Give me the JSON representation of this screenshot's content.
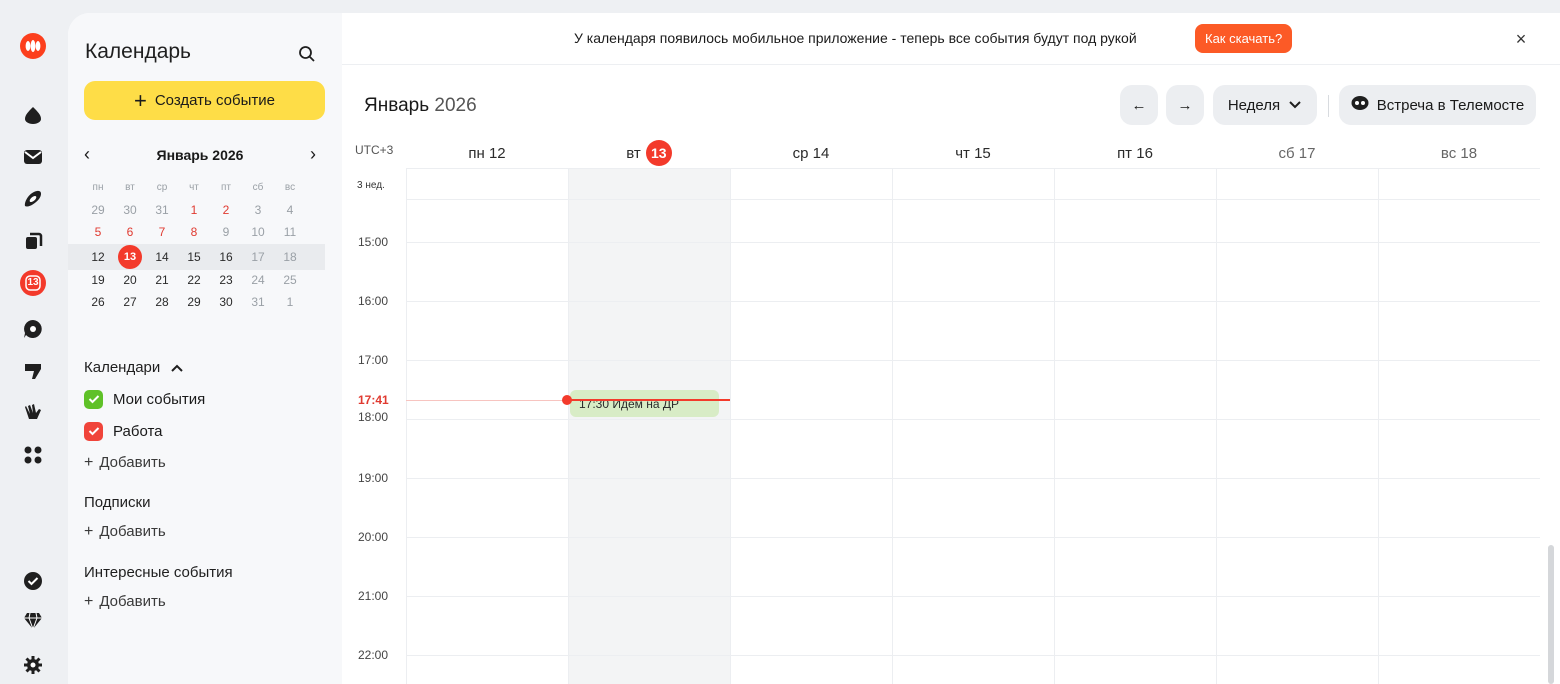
{
  "app": {
    "title": "Календарь"
  },
  "rail": {
    "icons": [
      "logo-icon",
      "drop-icon",
      "mail-icon",
      "disk-icon",
      "docs-icon",
      "calendar-icon",
      "chat-icon",
      "forms-icon",
      "hand-icon",
      "apps-icon",
      "done-icon",
      "gem-icon",
      "settings-icon"
    ],
    "calendar_badge": "13"
  },
  "sidebar": {
    "create_label": "Создать событие",
    "mini_cal": {
      "title": "Январь 2026",
      "dow": [
        "пн",
        "вт",
        "ср",
        "чт",
        "пт",
        "сб",
        "вс"
      ],
      "weeks": [
        [
          "29",
          "30",
          "31",
          "1",
          "2",
          "3",
          "4"
        ],
        [
          "5",
          "6",
          "7",
          "8",
          "9",
          "10",
          "11"
        ],
        [
          "12",
          "13",
          "14",
          "15",
          "16",
          "17",
          "18"
        ],
        [
          "19",
          "20",
          "21",
          "22",
          "23",
          "24",
          "25"
        ],
        [
          "26",
          "27",
          "28",
          "29",
          "30",
          "31",
          "1"
        ]
      ]
    },
    "calendars_title": "Календари",
    "calendars": [
      {
        "name": "Мои события",
        "color": "#5fc128"
      },
      {
        "name": "Работа",
        "color": "#f0443a"
      }
    ],
    "add_label": "Добавить",
    "subscriptions_title": "Подписки",
    "interesting_title": "Интересные события"
  },
  "banner": {
    "text": "У календаря появилось мобильное приложение - теперь все события будут под рукой",
    "button": "Как скачать?",
    "close": "×"
  },
  "toolbar": {
    "month": "Январь",
    "year": "2026",
    "prev": "←",
    "next": "→",
    "view": "Неделя",
    "telemost": "Встреча в Телемосте"
  },
  "grid": {
    "timezone": "UTC+3",
    "week_label": "3 нед.",
    "days": [
      {
        "dow": "пн",
        "num": "12"
      },
      {
        "dow": "вт",
        "num": "13"
      },
      {
        "dow": "ср",
        "num": "14"
      },
      {
        "dow": "чт",
        "num": "15"
      },
      {
        "dow": "пт",
        "num": "16"
      },
      {
        "dow": "сб",
        "num": "17"
      },
      {
        "dow": "вс",
        "num": "18"
      }
    ],
    "hours": [
      "15:00",
      "16:00",
      "17:00",
      "18:00",
      "19:00",
      "20:00",
      "21:00",
      "22:00"
    ],
    "now_time": "17:41",
    "event": {
      "time": "17:30",
      "title": "Идем на ДР"
    }
  }
}
